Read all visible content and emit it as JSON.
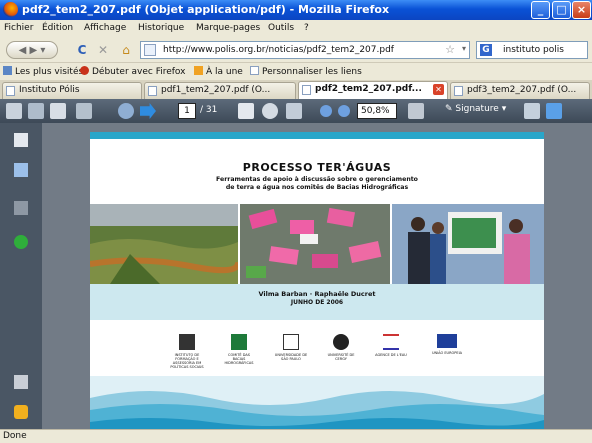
{
  "window": {
    "title": "pdf2_tem2_207.pdf (Objet application/pdf) - Mozilla Firefox"
  },
  "menu": [
    "Fichier",
    "Édition",
    "Affichage",
    "Historique",
    "Marque-pages",
    "Outils",
    "?"
  ],
  "nav": {
    "url": "http://www.polis.org.br/noticias/pdf2_tem2_207.pdf",
    "search_value": "instituto polis"
  },
  "bookmarks": [
    "Les plus visités",
    "Débuter avec Firefox",
    "À la une",
    "Personnaliser les liens"
  ],
  "tabs": [
    "Instituto Pólis",
    "pdf1_tem2_207.pdf (O...",
    "pdf2_tem2_207.pdf...",
    "pdf3_tem2_207.pdf (O..."
  ],
  "pdf_toolbar": {
    "page": "1",
    "total": "/ 31",
    "zoom": "50,8%",
    "signature": "Signature"
  },
  "document": {
    "title": "PROCESSO TER'ÁGUAS",
    "subtitle_1": "Ferramentas de apoio à discussão sobre o gerenciamento",
    "subtitle_2": "de terra e água nos comitês de Bacias Hidrográficas",
    "authors": "Vilma Barban · Raphaële Ducret",
    "date": "JUNHO DE 2006",
    "logos": [
      {
        "name": "instituto-polis",
        "caption": "INSTITUTO DE FORMAÇÃO E ASSESSORIA EM POLÍTICAS SOCIAIS"
      },
      {
        "name": "cbh",
        "caption": "COMITÊ DAS BACIAS HIDROGRÁFICAS"
      },
      {
        "name": "usp",
        "caption": "UNIVERSIDADE DE SÃO PAULO"
      },
      {
        "name": "university",
        "caption": "UNIVERSITÉ DE CERGY"
      },
      {
        "name": "agency",
        "caption": "AGENCE DE L'EAU"
      },
      {
        "name": "european-union",
        "caption": "UNIÃO EUROPEIA"
      }
    ]
  },
  "status": "Done"
}
